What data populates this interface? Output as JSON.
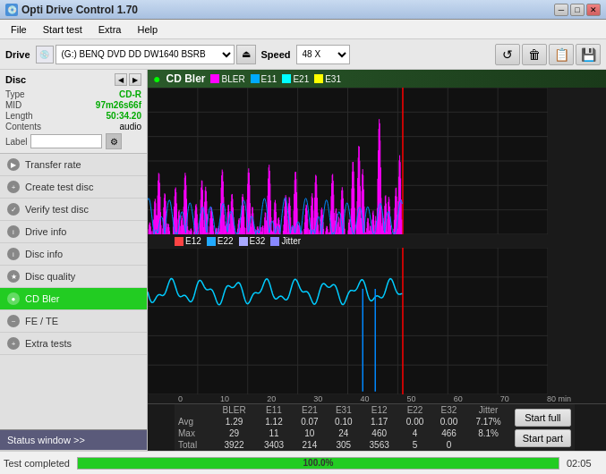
{
  "titleBar": {
    "icon": "💿",
    "title": "Opti Drive Control 1.70",
    "minimize": "─",
    "maximize": "□",
    "close": "✕"
  },
  "menuBar": {
    "items": [
      "File",
      "Start test",
      "Extra",
      "Help"
    ]
  },
  "driveBar": {
    "driveLabel": "Drive",
    "driveValue": "(G:)  BENQ DVD DD DW1640 BSRB",
    "speedLabel": "Speed",
    "speedValue": "48 X"
  },
  "disc": {
    "title": "Disc",
    "type": {
      "label": "Type",
      "value": "CD-R"
    },
    "mid": {
      "label": "MID",
      "value": "97m26s66f"
    },
    "length": {
      "label": "Length",
      "value": "50:34.20"
    },
    "contents": {
      "label": "Contents",
      "value": "audio"
    },
    "label": {
      "label": "Label",
      "value": ""
    }
  },
  "sidebar": {
    "items": [
      {
        "id": "transfer-rate",
        "label": "Transfer rate",
        "active": false
      },
      {
        "id": "create-test-disc",
        "label": "Create test disc",
        "active": false
      },
      {
        "id": "verify-test-disc",
        "label": "Verify test disc",
        "active": false
      },
      {
        "id": "drive-info",
        "label": "Drive info",
        "active": false
      },
      {
        "id": "disc-info",
        "label": "Disc info",
        "active": false
      },
      {
        "id": "disc-quality",
        "label": "Disc quality",
        "active": false
      },
      {
        "id": "cd-bler",
        "label": "CD Bler",
        "active": true
      },
      {
        "id": "fe-te",
        "label": "FE / TE",
        "active": false
      },
      {
        "id": "extra-tests",
        "label": "Extra tests",
        "active": false
      }
    ],
    "statusWindow": "Status window >>"
  },
  "chart": {
    "title": "CD Bler",
    "legend1": [
      "BLER",
      "E11",
      "E21",
      "E31"
    ],
    "legend1Colors": [
      "#ff00ff",
      "#00aaff",
      "#00ffff",
      "#ffff00"
    ],
    "legend2": [
      "E12",
      "E22",
      "E32",
      "Jitter"
    ],
    "legend2Colors": [
      "#ff4444",
      "#22aaff",
      "#aaaaff",
      "#8888ff"
    ],
    "xMax": 80,
    "yMax1": 30,
    "yMax2": 500,
    "redLineX": 51
  },
  "stats": {
    "headers": [
      "",
      "BLER",
      "E11",
      "E21",
      "E31",
      "E12",
      "E22",
      "E32",
      "Jitter"
    ],
    "rows": [
      {
        "label": "Avg",
        "values": [
          "1.29",
          "1.12",
          "0.07",
          "0.10",
          "1.17",
          "0.00",
          "0.00",
          "7.17%"
        ]
      },
      {
        "label": "Max",
        "values": [
          "29",
          "11",
          "10",
          "24",
          "460",
          "4",
          "466",
          "8.1%"
        ]
      },
      {
        "label": "Total",
        "values": [
          "3922",
          "3403",
          "214",
          "305",
          "3563",
          "5",
          "0",
          ""
        ]
      }
    ]
  },
  "buttons": {
    "startFull": "Start full",
    "startPart": "Start part"
  },
  "statusBar": {
    "text": "Test completed",
    "progress": "100.0%",
    "time": "02:05"
  }
}
